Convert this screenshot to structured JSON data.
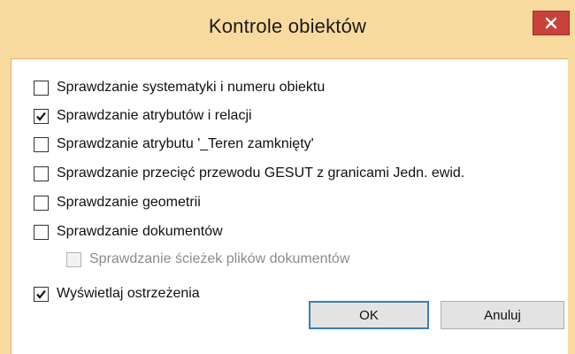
{
  "window": {
    "title": "Kontrole obiektów",
    "close_label": "×"
  },
  "options": [
    {
      "label": "Sprawdzanie systematyki i numeru obiektu",
      "checked": false,
      "enabled": true
    },
    {
      "label": "Sprawdzanie atrybutów i relacji",
      "checked": true,
      "enabled": true
    },
    {
      "label": "Sprawdzanie atrybutu '_Teren zamknięty'",
      "checked": false,
      "enabled": true
    },
    {
      "label": "Sprawdzanie przecięć przewodu GESUT z granicami Jedn. ewid.",
      "checked": false,
      "enabled": true
    },
    {
      "label": "Sprawdzanie geometrii",
      "checked": false,
      "enabled": true
    },
    {
      "label": "Sprawdzanie dokumentów",
      "checked": false,
      "enabled": true
    },
    {
      "label": "Sprawdzanie ścieżek plików dokumentów",
      "checked": false,
      "enabled": false
    },
    {
      "label": "Wyświetlaj ostrzeżenia",
      "checked": true,
      "enabled": true
    }
  ],
  "buttons": {
    "ok_label": "OK",
    "cancel_label": "Anuluj"
  },
  "colors": {
    "frame": "#f9da9e",
    "close": "#c7423a",
    "default_button_border": "#3c7fb1"
  }
}
